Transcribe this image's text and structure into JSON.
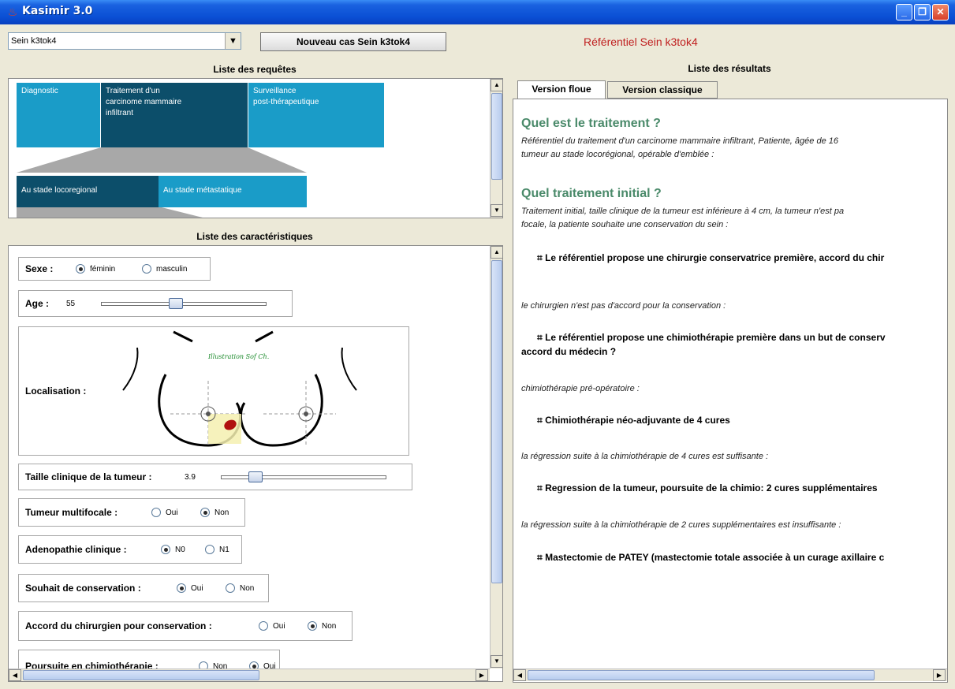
{
  "window": {
    "title": "Kasimir 3.0",
    "icon": "java-cup-icon"
  },
  "toolbar": {
    "case_select_value": "Sein k3tok4",
    "new_case_button": "Nouveau cas Sein k3tok4",
    "referential_title": "Référentiel Sein k3tok4"
  },
  "requests": {
    "title": "Liste des requêtes",
    "level1": [
      "Diagnostic",
      "Traitement d'un\ncarcinome mammaire\ninfiltrant",
      "Surveillance\npost-thérapeutique"
    ],
    "level2": [
      "Au stade locoregional",
      "Au stade métastatique"
    ]
  },
  "characteristics": {
    "title": "Liste des caractéristiques",
    "sexe": {
      "label": "Sexe :",
      "options": [
        "féminin",
        "masculin"
      ],
      "selected": 0
    },
    "age": {
      "label": "Age :",
      "value": "55",
      "level": 0.45
    },
    "localisation": {
      "label": "Localisation :",
      "image_caption": "Illustration Sof Ch."
    },
    "taille": {
      "label": "Taille clinique de la tumeur :",
      "value": "3.9",
      "level": 0.18
    },
    "multifocale": {
      "label": "Tumeur multifocale :",
      "options": [
        "Oui",
        "Non"
      ],
      "selected": 1
    },
    "adenopathie": {
      "label": "Adenopathie clinique :",
      "options": [
        "N0",
        "N1"
      ],
      "selected": 0
    },
    "souhait": {
      "label": "Souhait de conservation :",
      "options": [
        "Oui",
        "Non"
      ],
      "selected": 0
    },
    "accord": {
      "label": "Accord du chirurgien pour conservation :",
      "options": [
        "Oui",
        "Non"
      ],
      "selected": 1
    },
    "poursuite": {
      "label": "Poursuite en chimiothérapie :",
      "options": [
        "Non",
        "Oui"
      ],
      "selected": 1
    }
  },
  "results": {
    "title": "Liste des résultats",
    "tabs": [
      "Version floue",
      "Version classique"
    ],
    "active_tab": 0,
    "q1": "Quel est le traitement ?",
    "q1_text_1": "Référentiel du traitement d'un carcinome mammaire infiltrant, Patiente, âgée de 16",
    "q1_text_2": "tumeur au stade locorégional, opérable d'emblée :",
    "q2": "Quel traitement initial ?",
    "q2_text_1": "Traitement initial, taille clinique de la tumeur est inférieure à 4 cm, la tumeur n'est pa",
    "q2_text_2": "focale, la patiente souhaite une conservation du sein :",
    "r1": "⌗ Le référentiel propose une chirurgie conservatrice première, accord du chir",
    "c1": "le chirurgien n'est pas d'accord pour la conservation :",
    "r2_1": "⌗ Le référentiel propose une chimiothérapie première dans un but de conserv",
    "r2_2": "accord du médecin ?",
    "c2": "chimiothérapie pré-opératoire :",
    "r3": "⌗ Chimiothérapie néo-adjuvante de 4 cures",
    "c3": "la régression suite à la chimiothérapie de  4 cures est suffisante :",
    "r4": "⌗ Regression de la tumeur, poursuite de la chimio: 2 cures supplémentaires",
    "c4": "la régression suite à la chimiothérapie de 2 cures supplémentaires est insuffisante :",
    "r5": "⌗ Mastectomie de PATEY (mastectomie totale associée à un curage axillaire c"
  },
  "colors": {
    "title_bar": "#0a4fd4",
    "request_light": "#1a9cc8",
    "request_dark": "#0c4e6a",
    "heading_green": "#4a8a6a",
    "referential_red": "#c02020"
  }
}
